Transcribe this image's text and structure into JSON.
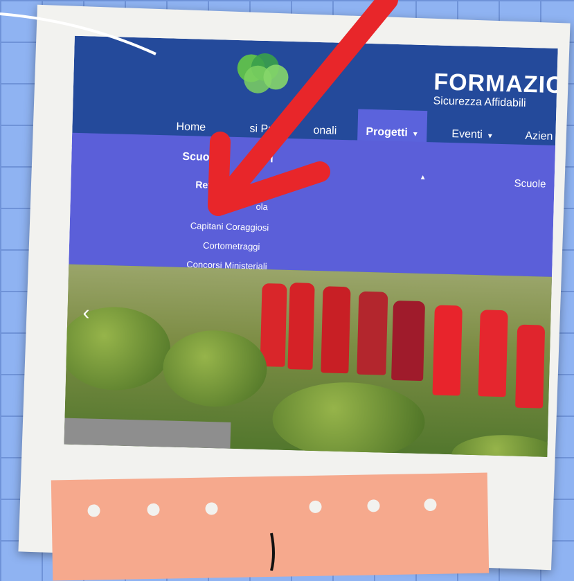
{
  "brand": {
    "title": "FORMAZIC",
    "tagline": "Sicurezza Affidabili"
  },
  "nav": {
    "items": [
      {
        "label": "Home"
      },
      {
        "label": "si Pro"
      },
      {
        "label": "onali"
      },
      {
        "label": "Progetti",
        "active": true
      },
      {
        "label": "Eventi"
      },
      {
        "label": "Azien"
      }
    ]
  },
  "dropdown": {
    "heading_a": "Scuole",
    "heading_b": "i",
    "subheading": "Rete",
    "links": [
      {
        "label": "Ca"
      },
      {
        "label": "ola"
      },
      {
        "label": "Capitani Coraggiosi"
      },
      {
        "label": "Cortometraggi"
      },
      {
        "label": "Concorsi Ministeriali"
      }
    ],
    "right_heading": "Scuole"
  },
  "colors": {
    "header": "#244a9b",
    "dropdown": "#5b5fd9",
    "active_tab": "#5b63dc",
    "arrow": "#e8262a",
    "tape": "#f6a98d",
    "grid": "#8fb3f2"
  },
  "icons": {
    "logo": "green-overlapping-circles-logo",
    "slider_prev": "chevron-left-icon",
    "caret": "caret-down-icon"
  }
}
